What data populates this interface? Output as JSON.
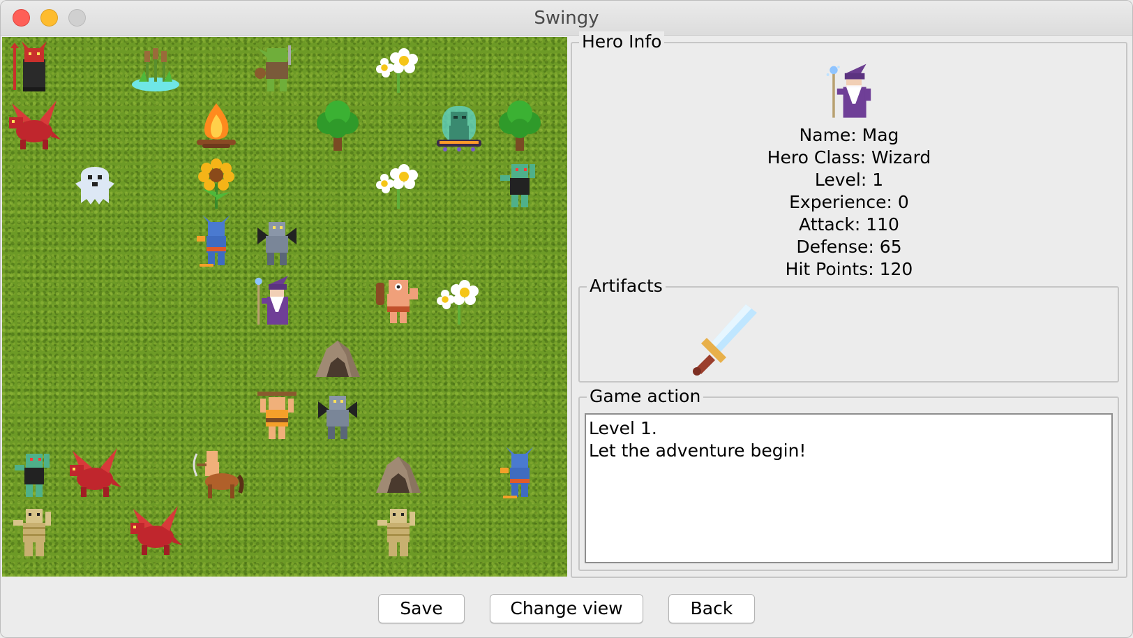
{
  "window": {
    "title": "Swingy"
  },
  "map": {
    "cells": [
      {
        "icon": "devil-icon",
        "col": 0,
        "row": 0
      },
      {
        "icon": "swamp-reeds-icon",
        "col": 2,
        "row": 0
      },
      {
        "icon": "goblin-icon",
        "col": 4,
        "row": 0
      },
      {
        "icon": "daisy-flowers-icon",
        "col": 6,
        "row": 0
      },
      {
        "icon": "red-dragon-icon",
        "col": 0,
        "row": 1
      },
      {
        "icon": "campfire-icon",
        "col": 3,
        "row": 1
      },
      {
        "icon": "tree-icon",
        "col": 5,
        "row": 1
      },
      {
        "icon": "alien-jar-icon",
        "col": 7,
        "row": 1
      },
      {
        "icon": "tree-icon",
        "col": 8,
        "row": 1
      },
      {
        "icon": "ghost-icon",
        "col": 1,
        "row": 2
      },
      {
        "icon": "sunflower-icon",
        "col": 3,
        "row": 2
      },
      {
        "icon": "daisy-flowers-icon",
        "col": 6,
        "row": 2
      },
      {
        "icon": "zombie-icon",
        "col": 8,
        "row": 2
      },
      {
        "icon": "blue-imp-icon",
        "col": 3,
        "row": 3
      },
      {
        "icon": "gargoyle-icon",
        "col": 4,
        "row": 3
      },
      {
        "icon": "wizard-icon",
        "col": 4,
        "row": 4
      },
      {
        "icon": "cyclops-icon",
        "col": 6,
        "row": 4
      },
      {
        "icon": "daisy-flowers-icon",
        "col": 7,
        "row": 4
      },
      {
        "icon": "cave-icon",
        "col": 5,
        "row": 5
      },
      {
        "icon": "barbarian-icon",
        "col": 4,
        "row": 6
      },
      {
        "icon": "gargoyle-icon",
        "col": 5,
        "row": 6
      },
      {
        "icon": "zombie-icon",
        "col": 0,
        "row": 7
      },
      {
        "icon": "red-dragon-icon",
        "col": 1,
        "row": 7
      },
      {
        "icon": "centaur-archer-icon",
        "col": 3,
        "row": 7
      },
      {
        "icon": "cave-icon",
        "col": 6,
        "row": 7
      },
      {
        "icon": "blue-imp-icon",
        "col": 8,
        "row": 7
      },
      {
        "icon": "mummy-icon",
        "col": 0,
        "row": 8
      },
      {
        "icon": "red-dragon-icon",
        "col": 2,
        "row": 8
      },
      {
        "icon": "mummy-icon",
        "col": 6,
        "row": 8
      }
    ]
  },
  "hero_info": {
    "legend": "Hero Info",
    "portrait_icon": "wizard-icon",
    "stats": [
      "Name: Mag",
      "Hero Class: Wizard",
      "Level: 1",
      "Experience: 0",
      "Attack: 110",
      "Defense: 65",
      "Hit Points: 120"
    ]
  },
  "artifacts": {
    "legend": "Artifacts",
    "items": [
      {
        "icon": "sword-icon"
      }
    ]
  },
  "game_action": {
    "legend": "Game action",
    "lines": [
      "Level 1.",
      "Let the adventure begin!"
    ]
  },
  "buttons": {
    "save": "Save",
    "change_view": "Change view",
    "back": "Back"
  }
}
